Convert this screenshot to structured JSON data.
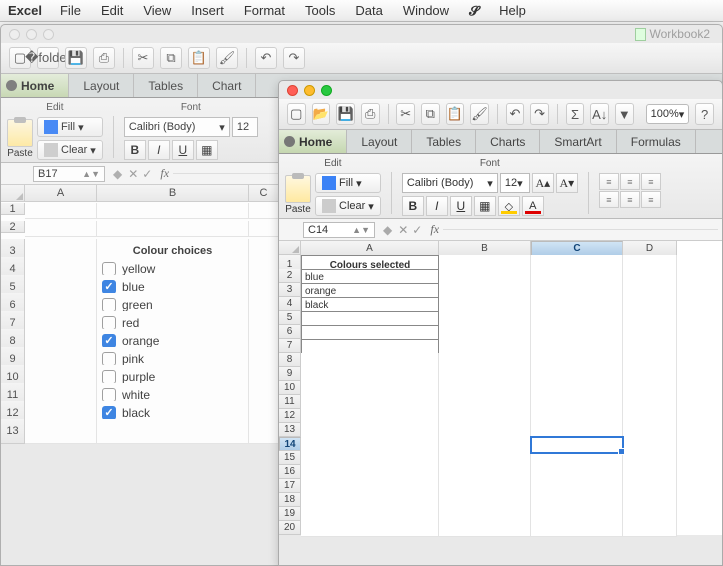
{
  "menubar": {
    "app": "Excel",
    "items": [
      "File",
      "Edit",
      "View",
      "Insert",
      "Format",
      "Tools",
      "Data",
      "Window"
    ],
    "help": "Help"
  },
  "workbook_bg": {
    "title": "Workbook2",
    "tabs": [
      "Home",
      "Layout",
      "Tables",
      "Chart"
    ],
    "active_tab": 0,
    "groups": {
      "edit": "Edit",
      "font": "Font"
    },
    "paste": "Paste",
    "fill": "Fill",
    "clear": "Clear",
    "font_name": "Calibri (Body)",
    "font_size": "12",
    "namebox": "B17",
    "columns": [
      "A",
      "B",
      "C"
    ],
    "header_cell": "Colour choices",
    "checkboxes": [
      {
        "label": "yellow",
        "checked": false
      },
      {
        "label": "blue",
        "checked": true
      },
      {
        "label": "green",
        "checked": false
      },
      {
        "label": "red",
        "checked": false
      },
      {
        "label": "orange",
        "checked": true
      },
      {
        "label": "pink",
        "checked": false
      },
      {
        "label": "purple",
        "checked": false
      },
      {
        "label": "white",
        "checked": false
      },
      {
        "label": "black",
        "checked": true
      }
    ]
  },
  "workbook_fg": {
    "zoom": "100%",
    "tabs": [
      "Home",
      "Layout",
      "Tables",
      "Charts",
      "SmartArt",
      "Formulas"
    ],
    "active_tab": 0,
    "groups": {
      "edit": "Edit",
      "font": "Font"
    },
    "paste": "Paste",
    "fill": "Fill",
    "clear": "Clear",
    "font_name": "Calibri (Body)",
    "font_size": "12",
    "namebox": "C14",
    "columns": [
      "A",
      "B",
      "C",
      "D"
    ],
    "header_cell": "Colours selected",
    "values": [
      "blue",
      "orange",
      "black"
    ],
    "selected_cell": "C14"
  }
}
